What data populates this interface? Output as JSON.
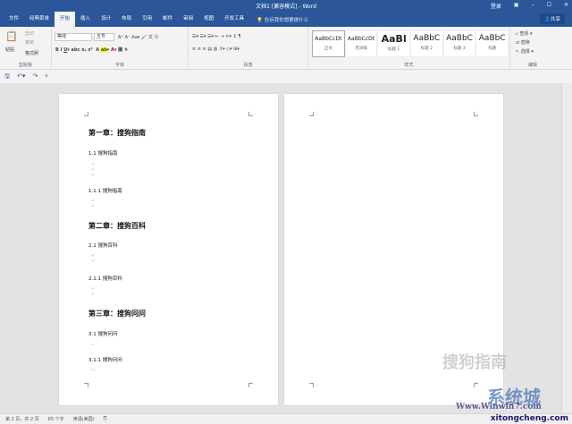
{
  "title": "文档1 [兼容模式] - Word",
  "title_controls": {
    "login": "登录",
    "restore_ribbon": "▣",
    "minimize": "–",
    "maximize": "☐",
    "close": "✕"
  },
  "tabs": [
    "文件",
    "经典菜单",
    "开始",
    "插入",
    "设计",
    "布局",
    "引用",
    "邮件",
    "审阅",
    "视图",
    "开发工具"
  ],
  "tell_me": "告诉我你想要做什么",
  "share": "共享",
  "clipboard": {
    "paste": "粘贴",
    "cut": "剪切",
    "copy": "复制",
    "format_painter": "格式刷",
    "label": "剪贴板"
  },
  "font": {
    "name": "等线",
    "size": "五号",
    "label": "字体"
  },
  "paragraph": {
    "label": "段落"
  },
  "styles": {
    "label": "样式",
    "items": [
      {
        "preview": "AaBbCcDt",
        "name": "正文"
      },
      {
        "preview": "AaBbCcDt",
        "name": "无间隔"
      },
      {
        "preview": "AaBl",
        "name": "标题 1"
      },
      {
        "preview": "AaBbC",
        "name": "标题 2"
      },
      {
        "preview": "AaBbC",
        "name": "标题 3"
      },
      {
        "preview": "AaBbC",
        "name": "标题"
      }
    ]
  },
  "editing": {
    "find": "查找",
    "replace": "替换",
    "select": "选择",
    "label": "编辑"
  },
  "document": {
    "lines": [
      {
        "text": "第一章：搜狗指南",
        "level": 1
      },
      {
        "text": "1.1 搜狗指南",
        "level": 2
      },
      {
        "text": "1.1.1 搜狗指南",
        "level": 3
      },
      {
        "text": "第二章：搜狗百科",
        "level": 1
      },
      {
        "text": "2.1 搜狗百科",
        "level": 2
      },
      {
        "text": "2.1.1 搜狗百科",
        "level": 3
      },
      {
        "text": "第三章：搜狗问问",
        "level": 1
      },
      {
        "text": "3.1 搜狗问问",
        "level": 2
      },
      {
        "text": "3.1.1 搜狗问问",
        "level": 3
      }
    ]
  },
  "status": {
    "page": "第 2 页，共 2 页",
    "words": "65 个字",
    "language": "英语(美国)"
  },
  "watermarks": {
    "sogou": "搜狗指南",
    "site1": "系统城",
    "site2": "Www.Winwin7.com",
    "site3": "xitongcheng.com"
  }
}
